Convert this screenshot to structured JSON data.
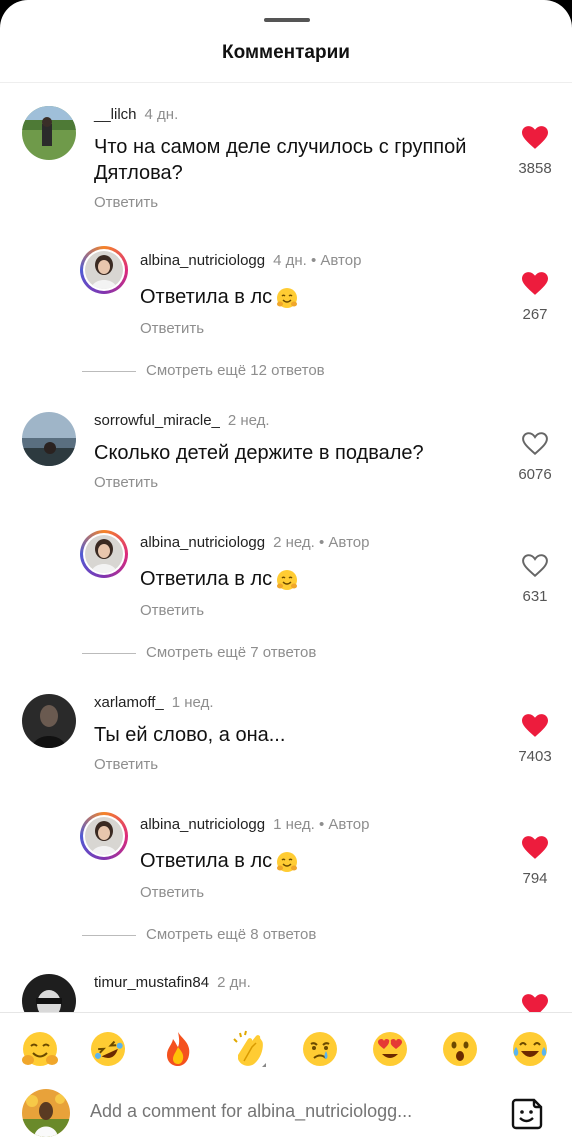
{
  "sheet": {
    "title": "Комментарии"
  },
  "view_more_prefix": "Смотреть ещё",
  "reply_label": "Ответить",
  "comments": [
    {
      "username": "__lilch",
      "time": "4 дн.",
      "text_lines": [
        "Что на самом деле случилось с группой",
        "Дятлова?"
      ],
      "liked": true,
      "likes": "3858",
      "reply": {
        "username": "albina_nutriciologg",
        "time": "4 дн.",
        "author_badge": "• Автор",
        "text": "Ответила в лс",
        "liked": true,
        "likes": "267"
      },
      "view_more": "Смотреть ещё 12 ответов"
    },
    {
      "username": "sorrowful_miracle_",
      "time": "2 нед.",
      "text_lines": [
        "Сколько детей держите в подвале?"
      ],
      "liked": false,
      "likes": "6076",
      "reply": {
        "username": "albina_nutriciologg",
        "time": "2 нед.",
        "author_badge": "• Автор",
        "text": "Ответила в лс",
        "liked": false,
        "likes": "631"
      },
      "view_more": "Смотреть ещё 7 ответов"
    },
    {
      "username": "xarlamoff_",
      "time": "1 нед.",
      "text_lines": [
        "Ты ей слово, а она..."
      ],
      "liked": true,
      "likes": "7403",
      "reply": {
        "username": "albina_nutriciologg",
        "time": "1 нед.",
        "author_badge": "• Автор",
        "text": "Ответила в лс",
        "liked": true,
        "likes": "794"
      },
      "view_more": "Смотреть ещё 8 ответов"
    },
    {
      "username": "timur_mustafin84",
      "time": "2 дн.",
      "liked": true
    }
  ],
  "emoji_bar": [
    "hugging-face",
    "rolling-laughing",
    "fire",
    "clapping-hands",
    "crying-face",
    "heart-eyes",
    "astonished-face",
    "tears-of-joy"
  ],
  "composer": {
    "placeholder": "Add a comment for albina_nutriciologg..."
  },
  "colors": {
    "like_red": "#ed1c3d",
    "muted_text": "#8e8e8e"
  }
}
